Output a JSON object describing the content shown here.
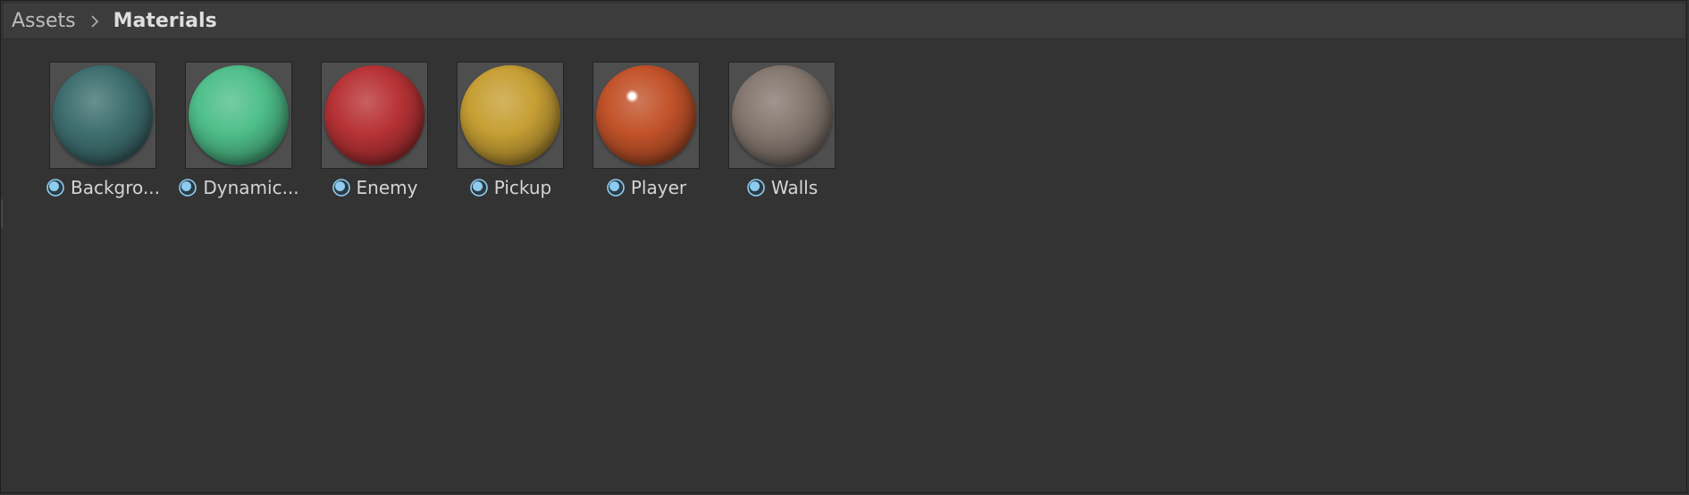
{
  "breadcrumb": {
    "root": "Assets",
    "separator_icon": "chevron-right-icon",
    "current": "Materials"
  },
  "icons": {
    "material": "material-sphere-icon"
  },
  "colors": {
    "panel_bg": "#333333",
    "header_bg": "#3c3c3c",
    "thumb_bg": "#4e4e4e",
    "icon_accent": "#8ecbf0"
  },
  "assets": [
    {
      "label": "Backgro...",
      "color": "#3f6f70",
      "glossy": false
    },
    {
      "label": "Dynamic...",
      "color": "#4fbf8a",
      "glossy": false
    },
    {
      "label": "Enemy",
      "color": "#b83336",
      "glossy": false
    },
    {
      "label": "Pickup",
      "color": "#c69f34",
      "glossy": false
    },
    {
      "label": "Player",
      "color": "#c2532a",
      "glossy": true
    },
    {
      "label": "Walls",
      "color": "#857870",
      "glossy": false
    }
  ]
}
